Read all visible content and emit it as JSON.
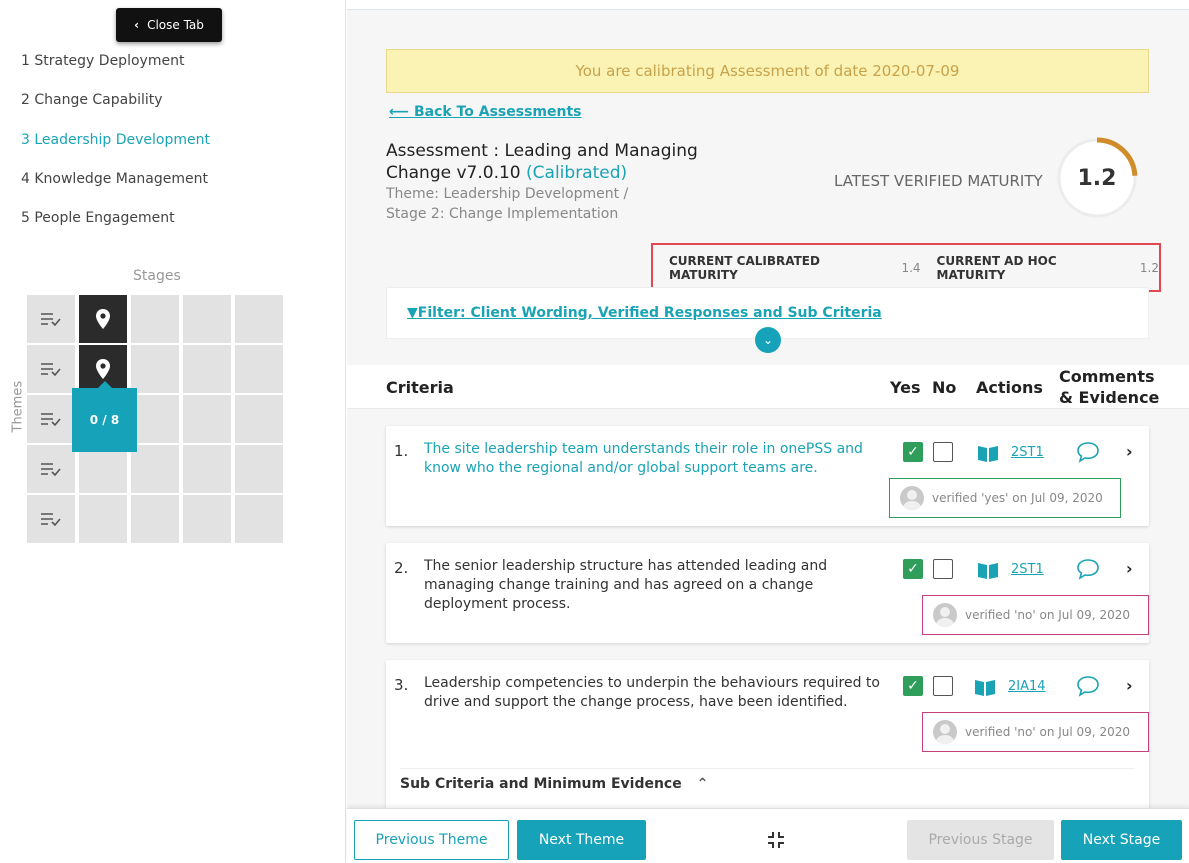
{
  "sidebar": {
    "close_tab": "Close Tab",
    "themes": [
      {
        "label": "1 Strategy Deployment",
        "active": false
      },
      {
        "label": "2 Change Capability",
        "active": false
      },
      {
        "label": "3 Leadership Development",
        "active": true
      },
      {
        "label": "4 Knowledge Management",
        "active": false
      },
      {
        "label": "5 People Engagement",
        "active": false
      }
    ],
    "stages_label": "Stages",
    "themes_label": "Themes",
    "tooltip": "0 / 8"
  },
  "banner": "You are calibrating Assessment of date 2020-07-09",
  "back_link": "Back To Assessments",
  "assessment": {
    "title": "Assessment : Leading and Managing Change v7.0.10",
    "status": "(Calibrated)",
    "theme": "Theme: Leadership Development /",
    "stage": "Stage 2: Change Implementation"
  },
  "maturity": {
    "latest_label": "LATEST VERIFIED MATURITY",
    "latest_value": "1.2",
    "latest_fraction": 0.24,
    "calibrated_label": "CURRENT CALIBRATED MATURITY",
    "calibrated_value": "1.4",
    "adhoc_label": "CURRENT AD HOC MATURITY",
    "adhoc_value": "1.2"
  },
  "filter": "Filter: Client Wording, Verified Responses and Sub Criteria",
  "table": {
    "criteria": "Criteria",
    "yes": "Yes",
    "no": "No",
    "actions": "Actions",
    "comments_line1": "Comments",
    "comments_line2": "& Evidence"
  },
  "criteria": [
    {
      "num": "1.",
      "text": "The site leadership team understands their role in onePSS and know who the regional and/or global support teams are.",
      "code": "2ST1",
      "verified": "verified 'yes' on Jul 09, 2020"
    },
    {
      "num": "2.",
      "text": "The senior leadership structure has attended leading and managing change training and has agreed on a change deployment process.",
      "code": "2ST1",
      "verified": "verified 'no' on Jul 09, 2020"
    },
    {
      "num": "3.",
      "text": "Leadership competencies to underpin the behaviours required to drive and support the change process, have been identified.",
      "code": "2IA14",
      "verified": "verified 'no' on Jul 09, 2020"
    }
  ],
  "sub_criteria": "Sub Criteria and Minimum Evidence",
  "footer": {
    "previous_theme": "Previous Theme",
    "next_theme": "Next Theme",
    "previous_stage": "Previous Stage",
    "next_stage": "Next Stage"
  },
  "colors": {
    "accent": "#16a2b8",
    "yes": "#2e9e5a",
    "no": "#c5407a",
    "highlight": "#e3474f"
  }
}
